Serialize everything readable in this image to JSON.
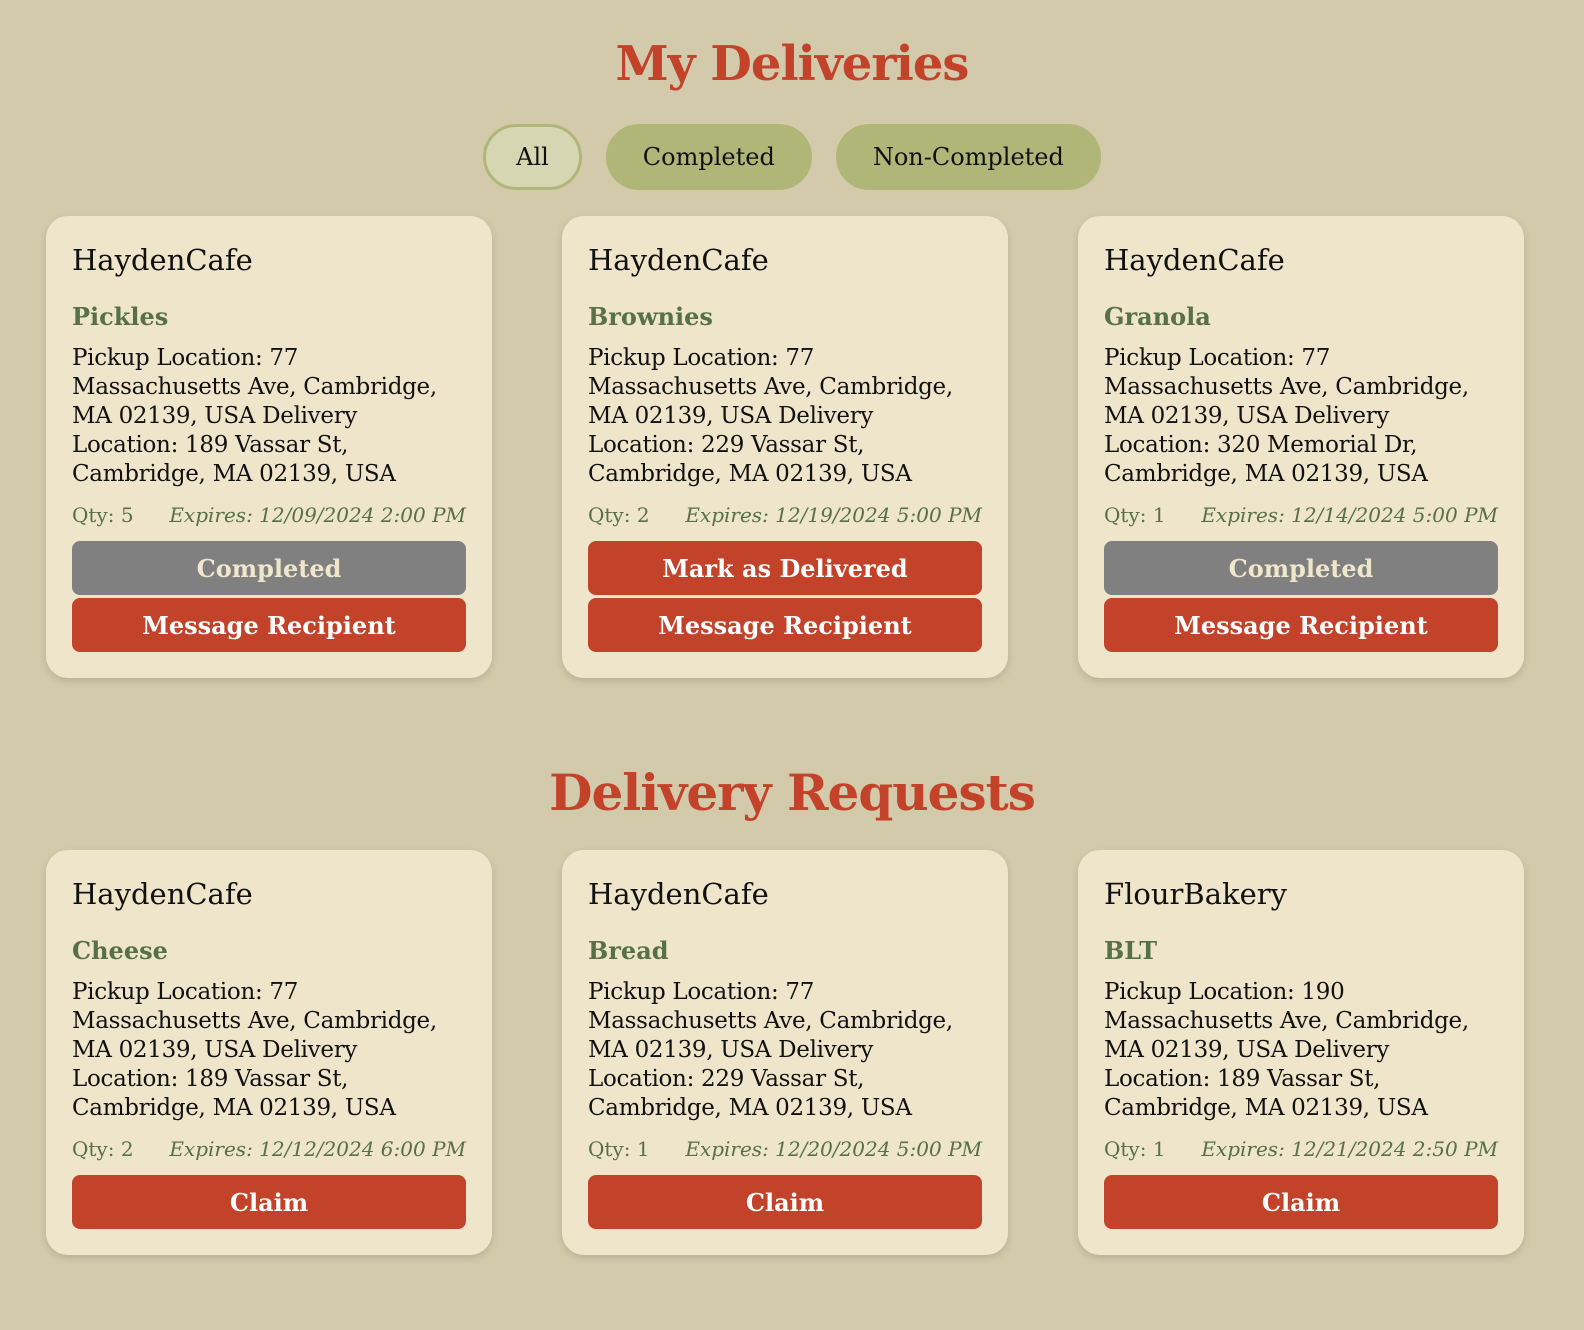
{
  "my_deliveries": {
    "title": "My Deliveries",
    "filters": [
      {
        "label": "All",
        "active": true
      },
      {
        "label": "Completed",
        "active": false
      },
      {
        "label": "Non-Completed",
        "active": false
      }
    ],
    "cards": [
      {
        "vendor": "HaydenCafe",
        "item": "Pickles",
        "address": "Pickup Location: 77 Massachusetts Ave, Cambridge, MA 02139, USA Delivery Location: 189 Vassar St, Cambridge, MA 02139, USA",
        "qty": "Qty: 5",
        "expires": "Expires: 12/09/2024 2:00 PM",
        "status_button": "Completed",
        "message_button": "Message Recipient"
      },
      {
        "vendor": "HaydenCafe",
        "item": "Brownies",
        "address": "Pickup Location: 77 Massachusetts Ave, Cambridge, MA 02139, USA Delivery Location: 229 Vassar St, Cambridge, MA 02139, USA",
        "qty": "Qty: 2",
        "expires": "Expires: 12/19/2024 5:00 PM",
        "status_button": "Mark as Delivered",
        "message_button": "Message Recipient"
      },
      {
        "vendor": "HaydenCafe",
        "item": "Granola",
        "address": "Pickup Location: 77 Massachusetts Ave, Cambridge, MA 02139, USA Delivery Location: 320 Memorial Dr, Cambridge, MA 02139, USA",
        "qty": "Qty: 1",
        "expires": "Expires: 12/14/2024 5:00 PM",
        "status_button": "Completed",
        "message_button": "Message Recipient"
      }
    ]
  },
  "delivery_requests": {
    "title": "Delivery Requests",
    "cards": [
      {
        "vendor": "HaydenCafe",
        "item": "Cheese",
        "address": "Pickup Location: 77 Massachusetts Ave, Cambridge, MA 02139, USA Delivery Location: 189 Vassar St, Cambridge, MA 02139, USA",
        "qty": "Qty: 2",
        "expires": "Expires: 12/12/2024 6:00 PM",
        "claim_button": "Claim"
      },
      {
        "vendor": "HaydenCafe",
        "item": "Bread",
        "address": "Pickup Location: 77 Massachusetts Ave, Cambridge, MA 02139, USA Delivery Location: 229 Vassar St, Cambridge, MA 02139, USA",
        "qty": "Qty: 1",
        "expires": "Expires: 12/20/2024 5:00 PM",
        "claim_button": "Claim"
      },
      {
        "vendor": "FlourBakery",
        "item": "BLT",
        "address": "Pickup Location: 190 Massachusetts Ave, Cambridge, MA 02139, USA Delivery Location: 189 Vassar St, Cambridge, MA 02139, USA",
        "qty": "Qty: 1",
        "expires": "Expires: 12/21/2024 2:50 PM",
        "claim_button": "Claim"
      }
    ]
  },
  "colors": {
    "background": "#d3c9ab",
    "card": "#efe5ca",
    "accent_red": "#c2432a",
    "item_green": "#577048",
    "filter_green": "#b0b678",
    "completed_gray": "#808080"
  }
}
